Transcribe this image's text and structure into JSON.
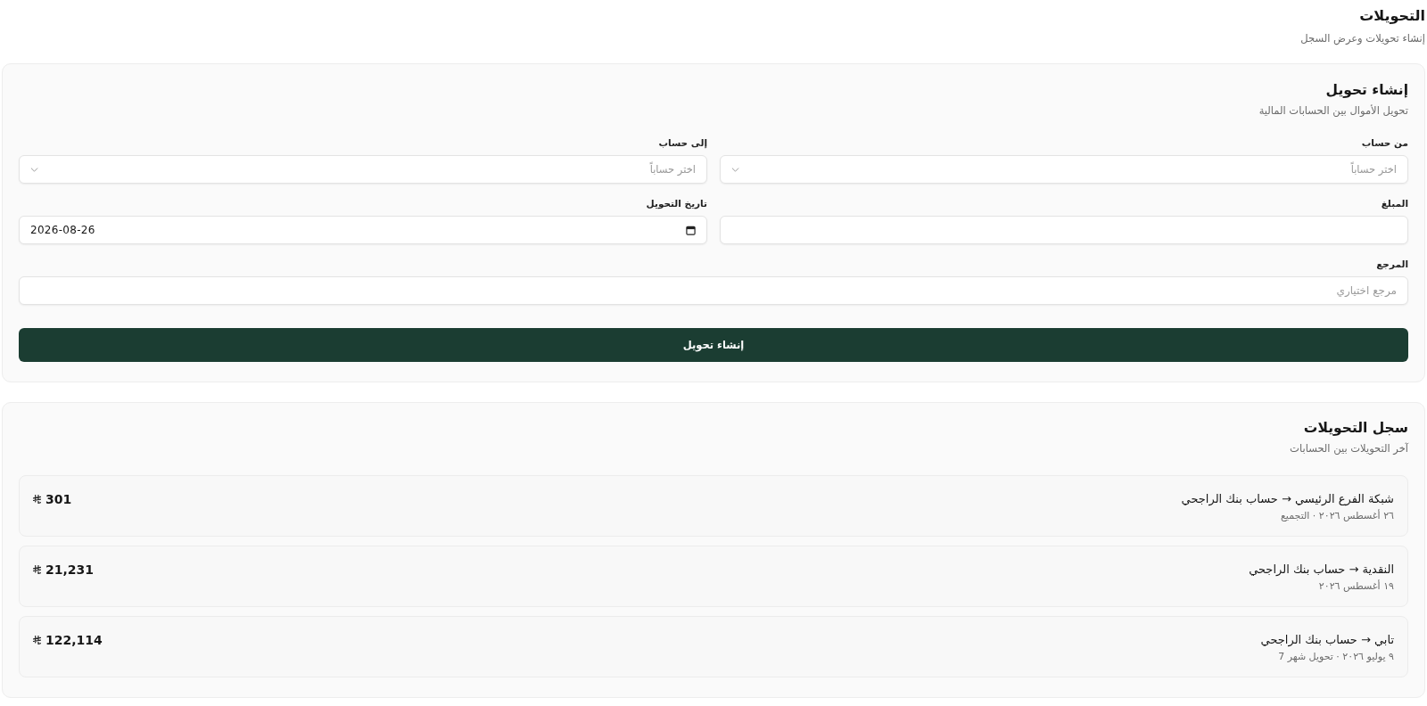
{
  "page": {
    "title": "التحويلات",
    "subtitle": "إنشاء تحويلات وعرض السجل"
  },
  "create_card": {
    "title": "إنشاء تحويل",
    "subtitle": "تحويل الأموال بين الحسابات المالية",
    "field_rows": [
      [
        {
          "kind": "select",
          "label": "من حساب",
          "placeholder": "اختر حساباً"
        },
        {
          "kind": "select",
          "label": "إلى حساب",
          "placeholder": "اختر حساباً"
        }
      ],
      [
        {
          "kind": "text",
          "label": "المبلغ"
        },
        {
          "kind": "date",
          "label": "تاريخ التحويل",
          "value": "2026-08-26"
        }
      ],
      [
        {
          "kind": "text",
          "label": "المرجع",
          "placeholder": "مرجع اختياري"
        }
      ]
    ],
    "submit_button": "إنشاء تحويل"
  },
  "history_card": {
    "title": "سجل التحويلات",
    "subtitle": "آخر التحويلات بين الحسابات",
    "transfers": [
      {
        "route": "شبكة الفرع الرئيسي → حساب بنك الراجحي",
        "meta": "٢٦ أغسطس ٢٠٢٦ · التجميع",
        "amount": "301"
      },
      {
        "route": "النقدية → حساب بنك الراجحي",
        "meta": "١٩ أغسطس ٢٠٢٦",
        "amount": "21,231"
      },
      {
        "route": "تابي → حساب بنك الراجحي",
        "meta": "٩ يوليو ٢٠٢٦ · تحويل شهر 7",
        "amount": "122,114"
      }
    ]
  }
}
